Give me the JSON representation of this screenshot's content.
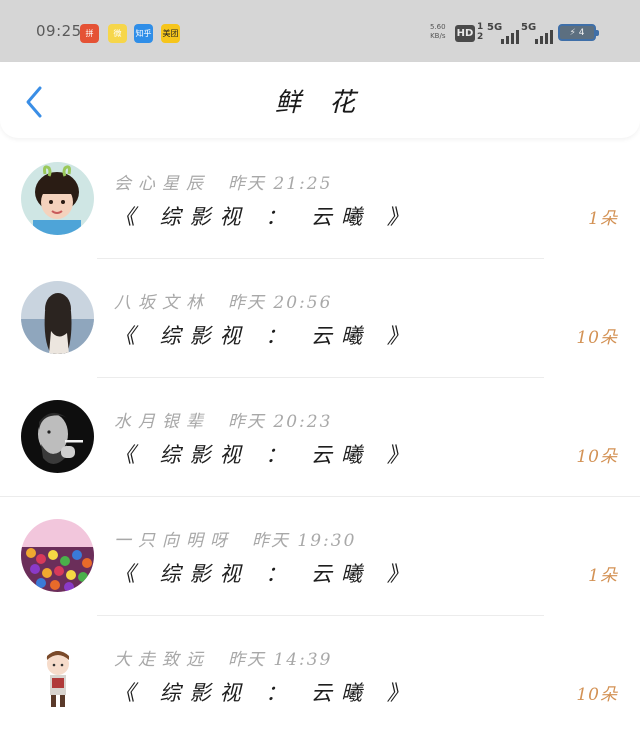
{
  "status_bar": {
    "time": "09:25",
    "app_icons": [
      "拼",
      "微",
      "知乎",
      "美团"
    ],
    "net_speed_value": "5.60",
    "net_speed_unit": "KB/s",
    "hd_label": "HD",
    "hd_sub_top": "1",
    "hd_sub_bottom": "2",
    "signal1_label": "5G",
    "signal2_label": "5G",
    "battery_label": "⚡ 4"
  },
  "header": {
    "back_icon": "chevron-left-icon",
    "title": "鲜 花",
    "accent_color": "#3a8ee6"
  },
  "items": [
    {
      "name": "会心星辰",
      "time": "昨天 21:25",
      "work": "《 综影视 ： 云曦 》",
      "count": "1朵",
      "avatar": "girl-child"
    },
    {
      "name": "八坂文林",
      "time": "昨天 20:56",
      "work": "《 综影视 ： 云曦 》",
      "count": "10朵",
      "avatar": "long-hair-woman"
    },
    {
      "name": "水月银辈",
      "time": "昨天 20:23",
      "work": "《 综影视 ： 云曦 》",
      "count": "10朵",
      "avatar": "man-smoking-bw"
    },
    {
      "name": "一只向明呀",
      "time": "昨天 19:30",
      "work": "《 综影视 ： 云曦 》",
      "count": "1朵",
      "avatar": "colorful-candy"
    },
    {
      "name": "大走致远",
      "time": "昨天 14:39",
      "work": "《 综影视 ： 云曦 》",
      "count": "10朵",
      "avatar": "anime-character"
    }
  ],
  "colors": {
    "count_color": "#d39255",
    "meta_color": "#a8a8a8",
    "statusbar_bg": "#d6d6d6"
  }
}
